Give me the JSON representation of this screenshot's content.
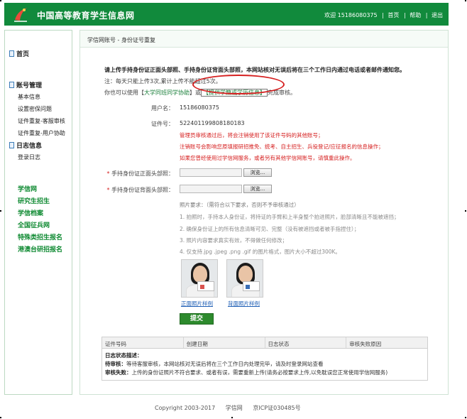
{
  "header": {
    "site_title": "中国高等教育学生信息网",
    "welcome": "欢迎 15186080375",
    "links": [
      "首页",
      "帮助",
      "退出"
    ]
  },
  "sidebar": {
    "home": "首页",
    "account_section": "账号管理",
    "account_items": [
      "基本信息",
      "设置密保问题",
      "证件重复-客服审核",
      "证件重复-用户协助"
    ],
    "log_section": "日志信息",
    "log_items": [
      "登录日志"
    ],
    "links": [
      "学信网",
      "研究生招生",
      "学信档案",
      "全国征兵网",
      "特殊类招生报名",
      "港澳台研招报名"
    ]
  },
  "main": {
    "breadcrumb": "学信网账号 - 身份证号重复",
    "intro_bold": "请上传手持身份证正面头部照、手持身份证背面头部照，本网站核对无误后将在三个工作日内通过电话或者邮件通知您。",
    "intro_note": "注：每天只能上传3次,累计上传不能超过5次。",
    "intro_alt_prefix": "你也可以使用【",
    "intro_alt_link1": "大学同班同学协助",
    "intro_alt_mid": "】或",
    "intro_alt_link2": "【提供学籍或学历信息】",
    "intro_alt_suffix": "完成审核。",
    "username_label": "用户名：",
    "username_value": "15186080375",
    "id_label": "证件号：",
    "id_value": "522401199808180183",
    "warnings": [
      "管理员审核通过后，将会注销使用了该证件号码的其他账号；",
      "注销账号会影响您原填报研招推免、统考、自主招生、兵役登记/应征报名的信息操作；",
      "如果您曾经使用过学信网服务，或者另有其他学信网账号，请慎重此操作。"
    ],
    "front_label": "手持身份证正面头部照：",
    "back_label": "手持身份证背面头部照：",
    "browse_label": "浏览...",
    "req_title": "照片要求：（需符合以下要求，否则不予审核通过）",
    "requirements": [
      "1. 拍照时，手持本人身份证，将持证的手臂和上半身整个拍进照片，脸部清晰且不能被遮挡；",
      "2. 确保身份证上的所有信息清晰可见、完整（没有被遮挡或者被手指捏住）；",
      "3. 照片内容要求真实有效，不得做任何修改；",
      "4. 仅支持.jpg .jpeg .png .gif 的图片格式，图片大小不超过300K。"
    ],
    "front_sample": "正面照片样例",
    "back_sample": "背面照片样例",
    "submit_label": "提交",
    "table_headers": [
      "证件号码",
      "创建日期",
      "日志状态",
      "审核失败原因"
    ],
    "log_desc_title": "日志状态描述：",
    "log_pending_label": "待审核：",
    "log_pending_text": "等待客服审核，本网站核对无误后将在三个工作日内处理完毕，请及时登录网站查看",
    "log_failed_label": "审核失败：",
    "log_failed_text": "上传的身份证照片不符合要求、或者有误，需要重新上传(请务必按要求上传,以免耽误您正常使用学信网服务)"
  },
  "footer": {
    "copyright": "Copyright 2003-2017",
    "site": "学信网",
    "icp": "京ICP证030485号"
  },
  "colors": {
    "header_bg": "#118a3c",
    "link_green": "#0f8a32",
    "warning_red": "#d62020",
    "annotation_red": "#d62020"
  }
}
